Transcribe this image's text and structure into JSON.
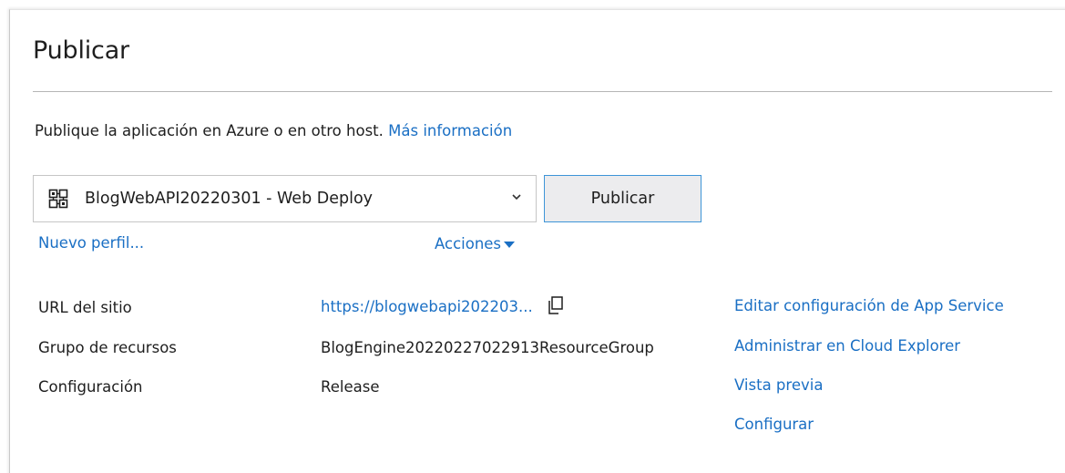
{
  "header": {
    "title": "Publicar"
  },
  "intro": {
    "text": "Publique la aplicación en Azure o en otro host.",
    "more_info_link": "Más información"
  },
  "profile": {
    "selected": "BlogWebAPI20220301 - Web Deploy",
    "icon": "web-deploy-icon",
    "chevron_icon": "chevron-down-icon"
  },
  "publish_button": {
    "label": "Publicar"
  },
  "links": {
    "new_profile": "Nuevo perfil...",
    "actions": "Acciones"
  },
  "details": {
    "site_url_label": "URL del sitio",
    "site_url_value": "https://blogwebapi202203...",
    "resource_group_label": "Grupo de recursos",
    "resource_group_value": "BlogEngine20220227022913ResourceGroup",
    "configuration_label": "Configuración",
    "configuration_value": "Release"
  },
  "side_actions": [
    {
      "label": "Editar configuración de App Service"
    },
    {
      "label": "Administrar en Cloud Explorer"
    },
    {
      "label": "Vista previa"
    },
    {
      "label": "Configurar"
    }
  ],
  "colors": {
    "link": "#1a6fc4",
    "button_border": "#3e95d8",
    "button_bg": "#ececee",
    "text": "#1e1e1e"
  }
}
